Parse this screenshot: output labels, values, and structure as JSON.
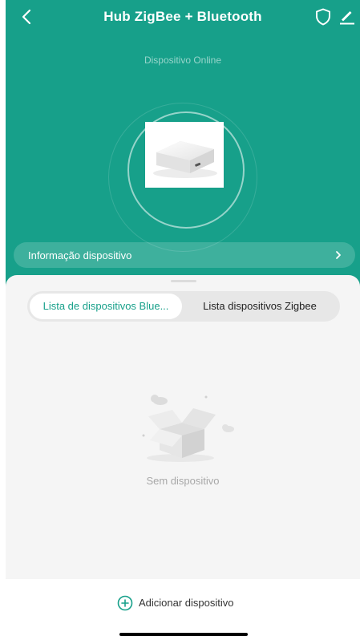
{
  "header": {
    "title": "Hub ZigBee + Bluetooth",
    "back_icon": "chevron-left-icon",
    "shield_icon": "shield-icon",
    "edit_icon": "pencil-icon"
  },
  "device": {
    "status": "Dispositivo Online",
    "image": "hub-device-image"
  },
  "info_row": {
    "label": "Informação dispositivo",
    "chevron": "›"
  },
  "tabs": [
    {
      "label": "Lista de dispositivos  Blue...",
      "active": true
    },
    {
      "label": "Lista dispositivos Zigbee",
      "active": false
    }
  ],
  "empty_state": {
    "icon": "empty-box-icon",
    "text": "Sem dispositivo"
  },
  "footer": {
    "add_label": "Adicionar dispositivo",
    "add_icon": "plus-circle-icon"
  },
  "colors": {
    "primary": "#17a08a",
    "sheet_bg": "#f5f5f5",
    "tab_track": "#e7e7e7",
    "muted_text": "#a8a8a8"
  }
}
